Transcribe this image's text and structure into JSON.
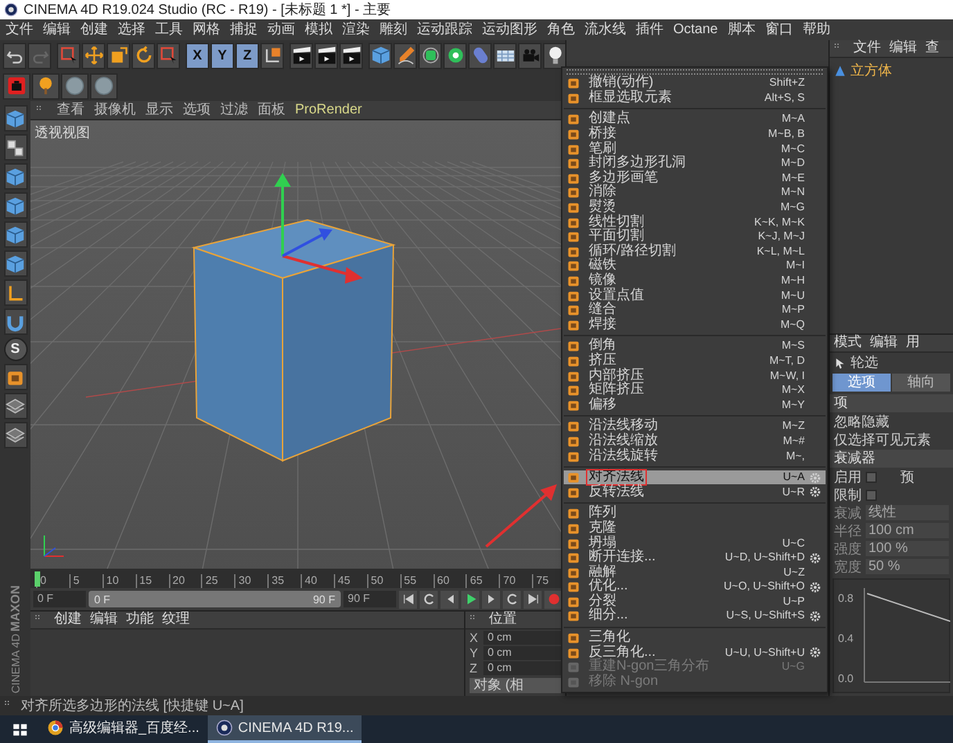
{
  "window": {
    "title": "CINEMA 4D R19.024 Studio (RC - R19) - [未标题 1 *] - 主要"
  },
  "menu_bar": [
    "文件",
    "编辑",
    "创建",
    "选择",
    "工具",
    "网格",
    "捕捉",
    "动画",
    "模拟",
    "渲染",
    "雕刻",
    "运动跟踪",
    "运动图形",
    "角色",
    "流水线",
    "插件",
    "Octane",
    "脚本",
    "窗口",
    "帮助"
  ],
  "toolbar": {
    "axis_buttons": [
      {
        "label": "X",
        "selected": true
      },
      {
        "label": "Y",
        "selected": true
      },
      {
        "label": "Z",
        "selected": true
      }
    ]
  },
  "left_toolbar": {
    "solo_label": "S"
  },
  "viewport": {
    "menu": [
      "查看",
      "摄像机",
      "显示",
      "选项",
      "过滤",
      "面板",
      "ProRender"
    ],
    "label": "透视视图"
  },
  "timeline": {
    "ticks": [
      "0",
      "5",
      "10",
      "15",
      "20",
      "25",
      "30",
      "35",
      "40",
      "45",
      "50",
      "55",
      "60",
      "65",
      "70",
      "75"
    ]
  },
  "transport": {
    "current_frame": "0 F",
    "range": {
      "start": "0 F",
      "end": "90 F",
      "level": 1
    },
    "end_frame": "90 F"
  },
  "material_manager": {
    "menu": [
      "创建",
      "编辑",
      "功能",
      "纹理"
    ]
  },
  "coordinates": {
    "header": "位置",
    "rows": [
      {
        "axis": "X",
        "value": "0 cm"
      },
      {
        "axis": "Y",
        "value": "0 cm"
      },
      {
        "axis": "Z",
        "value": "0 cm"
      }
    ],
    "button": "对象 (相"
  },
  "status_bar": "对齐所选多边形的法线 [快捷键 U~A]",
  "taskbar": {
    "items": [
      {
        "label": "高级编辑器_百度经...",
        "selected": false
      },
      {
        "label": "CINEMA 4D R19...",
        "selected": true
      }
    ]
  },
  "logo": {
    "brand": "MAXON",
    "product": "CINEMA 4D"
  },
  "object_manager": {
    "menu": [
      "文件",
      "编辑",
      "查"
    ],
    "objects": [
      {
        "name": "立方体",
        "selected": true
      }
    ]
  },
  "attribute_manager": {
    "menu": [
      "模式",
      "编辑",
      "用"
    ],
    "tool": "轮选",
    "tabs": [
      {
        "label": "选项",
        "selected": true
      },
      {
        "label": "轴向",
        "selected": false
      }
    ],
    "sections": [
      {
        "title": "项",
        "rows": [
          {
            "kind": "option",
            "label": "忽略隐藏"
          },
          {
            "kind": "option",
            "label": "仅选择可见元素"
          }
        ]
      },
      {
        "title": "衰减器",
        "rows": [
          {
            "kind": "checkbox",
            "label": "启用",
            "checked": false,
            "extra": "预"
          },
          {
            "kind": "checkbox",
            "label": "限制",
            "checked": false
          },
          {
            "kind": "value",
            "label": "衰减",
            "value": "线性",
            "disabled": true
          },
          {
            "kind": "value",
            "label": "半径",
            "value": "100 cm",
            "disabled": true
          },
          {
            "kind": "value",
            "label": "强度",
            "value": "100 %",
            "disabled": true
          },
          {
            "kind": "value",
            "label": "宽度",
            "value": "50 %",
            "disabled": true
          }
        ]
      }
    ],
    "curve_ticks": [
      "0.8",
      "0.4",
      "0.0"
    ]
  },
  "context_menu": {
    "groups": [
      [
        {
          "label": "撤销(动作)",
          "shortcut": "Shift+Z",
          "selected": false,
          "disabled": false
        },
        {
          "label": "框显选取元素",
          "shortcut": "Alt+S, S",
          "selected": false,
          "disabled": false
        }
      ],
      [
        {
          "label": "创建点",
          "shortcut": "M~A",
          "selected": false,
          "disabled": false
        },
        {
          "label": "桥接",
          "shortcut": "M~B, B",
          "selected": false,
          "disabled": false
        },
        {
          "label": "笔刷",
          "shortcut": "M~C",
          "selected": false,
          "disabled": false
        },
        {
          "label": "封闭多边形孔洞",
          "shortcut": "M~D",
          "selected": false,
          "disabled": false
        },
        {
          "label": "多边形画笔",
          "shortcut": "M~E",
          "selected": false,
          "disabled": false
        },
        {
          "label": "消除",
          "shortcut": "M~N",
          "selected": false,
          "disabled": false
        },
        {
          "label": "熨烫",
          "shortcut": "M~G",
          "selected": false,
          "disabled": false
        },
        {
          "label": "线性切割",
          "shortcut": "K~K, M~K",
          "selected": false,
          "disabled": false
        },
        {
          "label": "平面切割",
          "shortcut": "K~J, M~J",
          "selected": false,
          "disabled": false
        },
        {
          "label": "循环/路径切割",
          "shortcut": "K~L, M~L",
          "selected": false,
          "disabled": false
        },
        {
          "label": "磁铁",
          "shortcut": "M~I",
          "selected": false,
          "disabled": false
        },
        {
          "label": "镜像",
          "shortcut": "M~H",
          "selected": false,
          "disabled": false
        },
        {
          "label": "设置点值",
          "shortcut": "M~U",
          "selected": false,
          "disabled": false
        },
        {
          "label": "缝合",
          "shortcut": "M~P",
          "selected": false,
          "disabled": false
        },
        {
          "label": "焊接",
          "shortcut": "M~Q",
          "selected": false,
          "disabled": false
        }
      ],
      [
        {
          "label": "倒角",
          "shortcut": "M~S",
          "selected": false,
          "disabled": false
        },
        {
          "label": "挤压",
          "shortcut": "M~T, D",
          "selected": false,
          "disabled": false
        },
        {
          "label": "内部挤压",
          "shortcut": "M~W, I",
          "selected": false,
          "disabled": false
        },
        {
          "label": "矩阵挤压",
          "shortcut": "M~X",
          "selected": false,
          "disabled": false
        },
        {
          "label": "偏移",
          "shortcut": "M~Y",
          "selected": false,
          "disabled": false
        }
      ],
      [
        {
          "label": "沿法线移动",
          "shortcut": "M~Z",
          "selected": false,
          "disabled": false
        },
        {
          "label": "沿法线缩放",
          "shortcut": "M~#",
          "selected": false,
          "disabled": false
        },
        {
          "label": "沿法线旋转",
          "shortcut": "M~,",
          "selected": false,
          "disabled": false
        }
      ],
      [
        {
          "label": "对齐法线",
          "shortcut": "U~A",
          "options": true,
          "selected": true,
          "disabled": false
        },
        {
          "label": "反转法线",
          "shortcut": "U~R",
          "options": true,
          "selected": false,
          "disabled": false
        }
      ],
      [
        {
          "label": "阵列",
          "selected": false,
          "disabled": false
        },
        {
          "label": "克隆",
          "selected": false,
          "disabled": false
        },
        {
          "label": "坍塌",
          "shortcut": "U~C",
          "selected": false,
          "disabled": false
        },
        {
          "label": "断开连接...",
          "shortcut": "U~D, U~Shift+D",
          "options": true,
          "selected": false,
          "disabled": false
        },
        {
          "label": "融解",
          "shortcut": "U~Z",
          "selected": false,
          "disabled": false
        },
        {
          "label": "优化...",
          "shortcut": "U~O, U~Shift+O",
          "options": true,
          "selected": false,
          "disabled": false
        },
        {
          "label": "分裂",
          "shortcut": "U~P",
          "selected": false,
          "disabled": false
        },
        {
          "label": "细分...",
          "shortcut": "U~S, U~Shift+S",
          "options": true,
          "selected": false,
          "disabled": false
        }
      ],
      [
        {
          "label": "三角化",
          "selected": false,
          "disabled": false
        },
        {
          "label": "反三角化...",
          "shortcut": "U~U, U~Shift+U",
          "options": true,
          "selected": false,
          "disabled": false
        },
        {
          "label": "重建N-gon三角分布",
          "shortcut": "U~G",
          "selected": false,
          "disabled": true
        },
        {
          "label": "移除 N-gon",
          "selected": false,
          "disabled": true
        }
      ]
    ]
  }
}
